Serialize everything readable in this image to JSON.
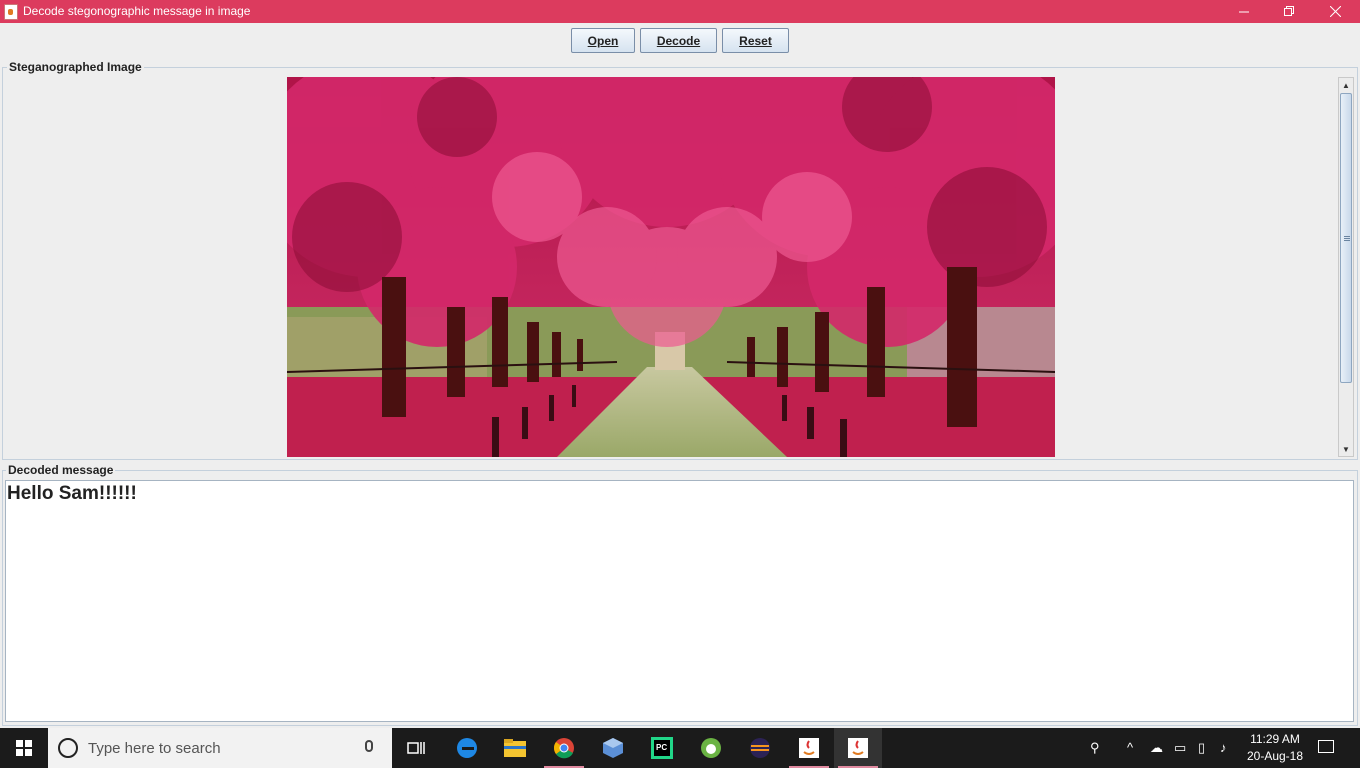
{
  "window": {
    "title": "Decode stegonographic message in image"
  },
  "toolbar": {
    "open_label": "Open",
    "decode_label": "Decode",
    "reset_label": "Reset"
  },
  "image_panel": {
    "title": "Steganographed Image"
  },
  "message_panel": {
    "title": "Decoded message",
    "text": "Hello Sam!!!!!!"
  },
  "taskbar": {
    "search_placeholder": "Type here to search",
    "apps": [
      "task-view",
      "edge",
      "file-explorer",
      "chrome",
      "virtualbox",
      "pycharm",
      "android-studio",
      "eclipse",
      "java",
      "java"
    ],
    "clock_time": "11:29 AM",
    "clock_date": "20-Aug-18"
  },
  "colors": {
    "titlebar": "#dc3b5e",
    "taskbar": "#1b1b1b"
  }
}
